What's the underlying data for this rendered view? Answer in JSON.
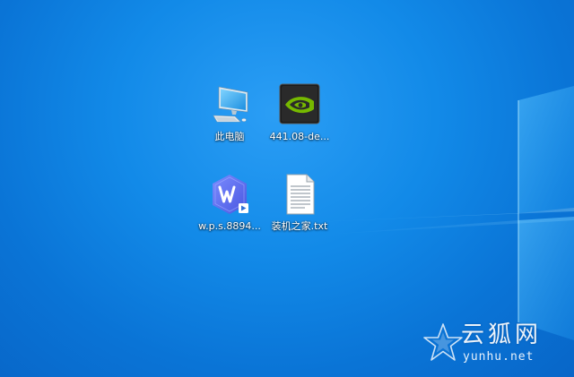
{
  "desktop": {
    "icons": [
      {
        "label": "此电脑",
        "icon": "this-pc-icon"
      },
      {
        "label": "441.08-de...",
        "icon": "nvidia-icon"
      },
      {
        "label": "w.p.s.8894...",
        "icon": "wps-icon"
      },
      {
        "label": "装机之家.txt",
        "icon": "text-file-icon"
      }
    ]
  },
  "watermark": {
    "brand": "云狐网",
    "url": "yunhu.net"
  },
  "colors": {
    "desktop_blue": "#128ae8",
    "nvidia_green": "#76b900",
    "wps_purple": "#5b6cf0"
  }
}
